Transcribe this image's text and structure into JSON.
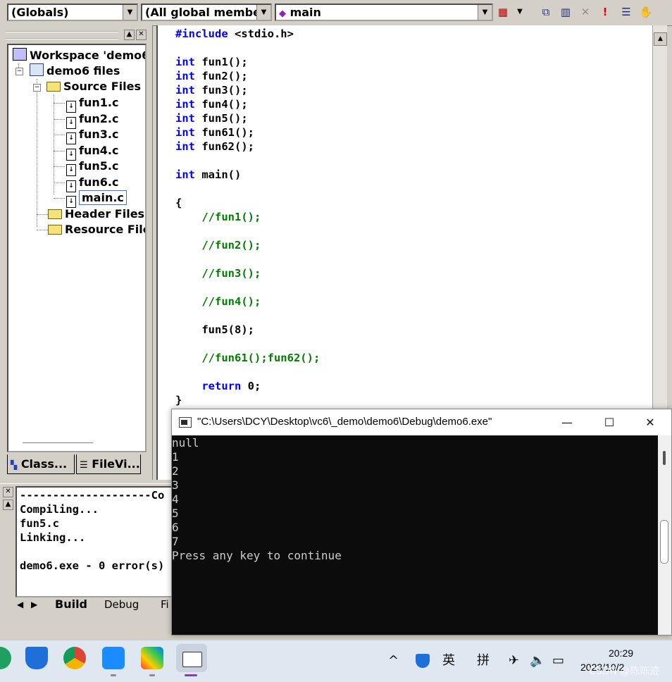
{
  "toolbar": {
    "scope_combo": "(Globals)",
    "members_combo": "(All global members",
    "function_combo": "main"
  },
  "workspace": {
    "tree": {
      "workspace_label": "Workspace 'demo6",
      "project_label": "demo6 files",
      "source_folder": "Source Files",
      "files": [
        "fun1.c",
        "fun2.c",
        "fun3.c",
        "fun4.c",
        "fun5.c",
        "fun6.c",
        "main.c"
      ],
      "selected_file": "main.c",
      "header_folder": "Header Files",
      "resource_folder": "Resource File"
    },
    "tabs": [
      "Class...",
      "FileVi..."
    ]
  },
  "editor": {
    "lines": [
      {
        "kw": "#include",
        "text": " <stdio.h>"
      },
      {
        "kw": "",
        "text": ""
      },
      {
        "kw": "int",
        "text": " fun1();"
      },
      {
        "kw": "int",
        "text": " fun2();"
      },
      {
        "kw": "int",
        "text": " fun3();"
      },
      {
        "kw": "int",
        "text": " fun4();"
      },
      {
        "kw": "int",
        "text": " fun5();"
      },
      {
        "kw": "int",
        "text": " fun61();"
      },
      {
        "kw": "int",
        "text": " fun62();"
      },
      {
        "kw": "",
        "text": ""
      },
      {
        "kw": "int",
        "text": " main()"
      },
      {
        "kw": "",
        "text": ""
      },
      {
        "kw": "",
        "text": "{"
      },
      {
        "comment": "    //fun1();"
      },
      {
        "kw": "",
        "text": ""
      },
      {
        "comment": "    //fun2();"
      },
      {
        "kw": "",
        "text": ""
      },
      {
        "comment": "    //fun3();"
      },
      {
        "kw": "",
        "text": ""
      },
      {
        "comment": "    //fun4();"
      },
      {
        "kw": "",
        "text": ""
      },
      {
        "kw": "",
        "text": "    fun5(8);"
      },
      {
        "kw": "",
        "text": ""
      },
      {
        "comment": "    //fun61();fun62();"
      },
      {
        "kw": "",
        "text": ""
      },
      {
        "kwi": "    return",
        "text": " 0;"
      },
      {
        "kw": "",
        "text": "}"
      }
    ]
  },
  "output": {
    "header_dashes": "--------------------Co",
    "lines": [
      "Compiling...",
      "fun5.c",
      "Linking...",
      "",
      "demo6.exe - 0 error(s)"
    ],
    "tabs": [
      "Build",
      "Debug",
      "Fi"
    ]
  },
  "console": {
    "title": "\"C:\\Users\\DCY\\Desktop\\vc6\\_demo\\demo6\\Debug\\demo6.exe\"",
    "lines": [
      "null",
      "1",
      "2",
      "3",
      "4",
      "5",
      "6",
      "7",
      "Press any key to continue"
    ],
    "minimize": "—",
    "maximize": "☐",
    "close": "✕"
  },
  "taskbar": {
    "tray_chevron": "^",
    "ime_lang": "英",
    "ime_mode": "拼",
    "time": "20:29",
    "date": "2023/10/2",
    "watermark": "CSDN @陈陈迹"
  }
}
